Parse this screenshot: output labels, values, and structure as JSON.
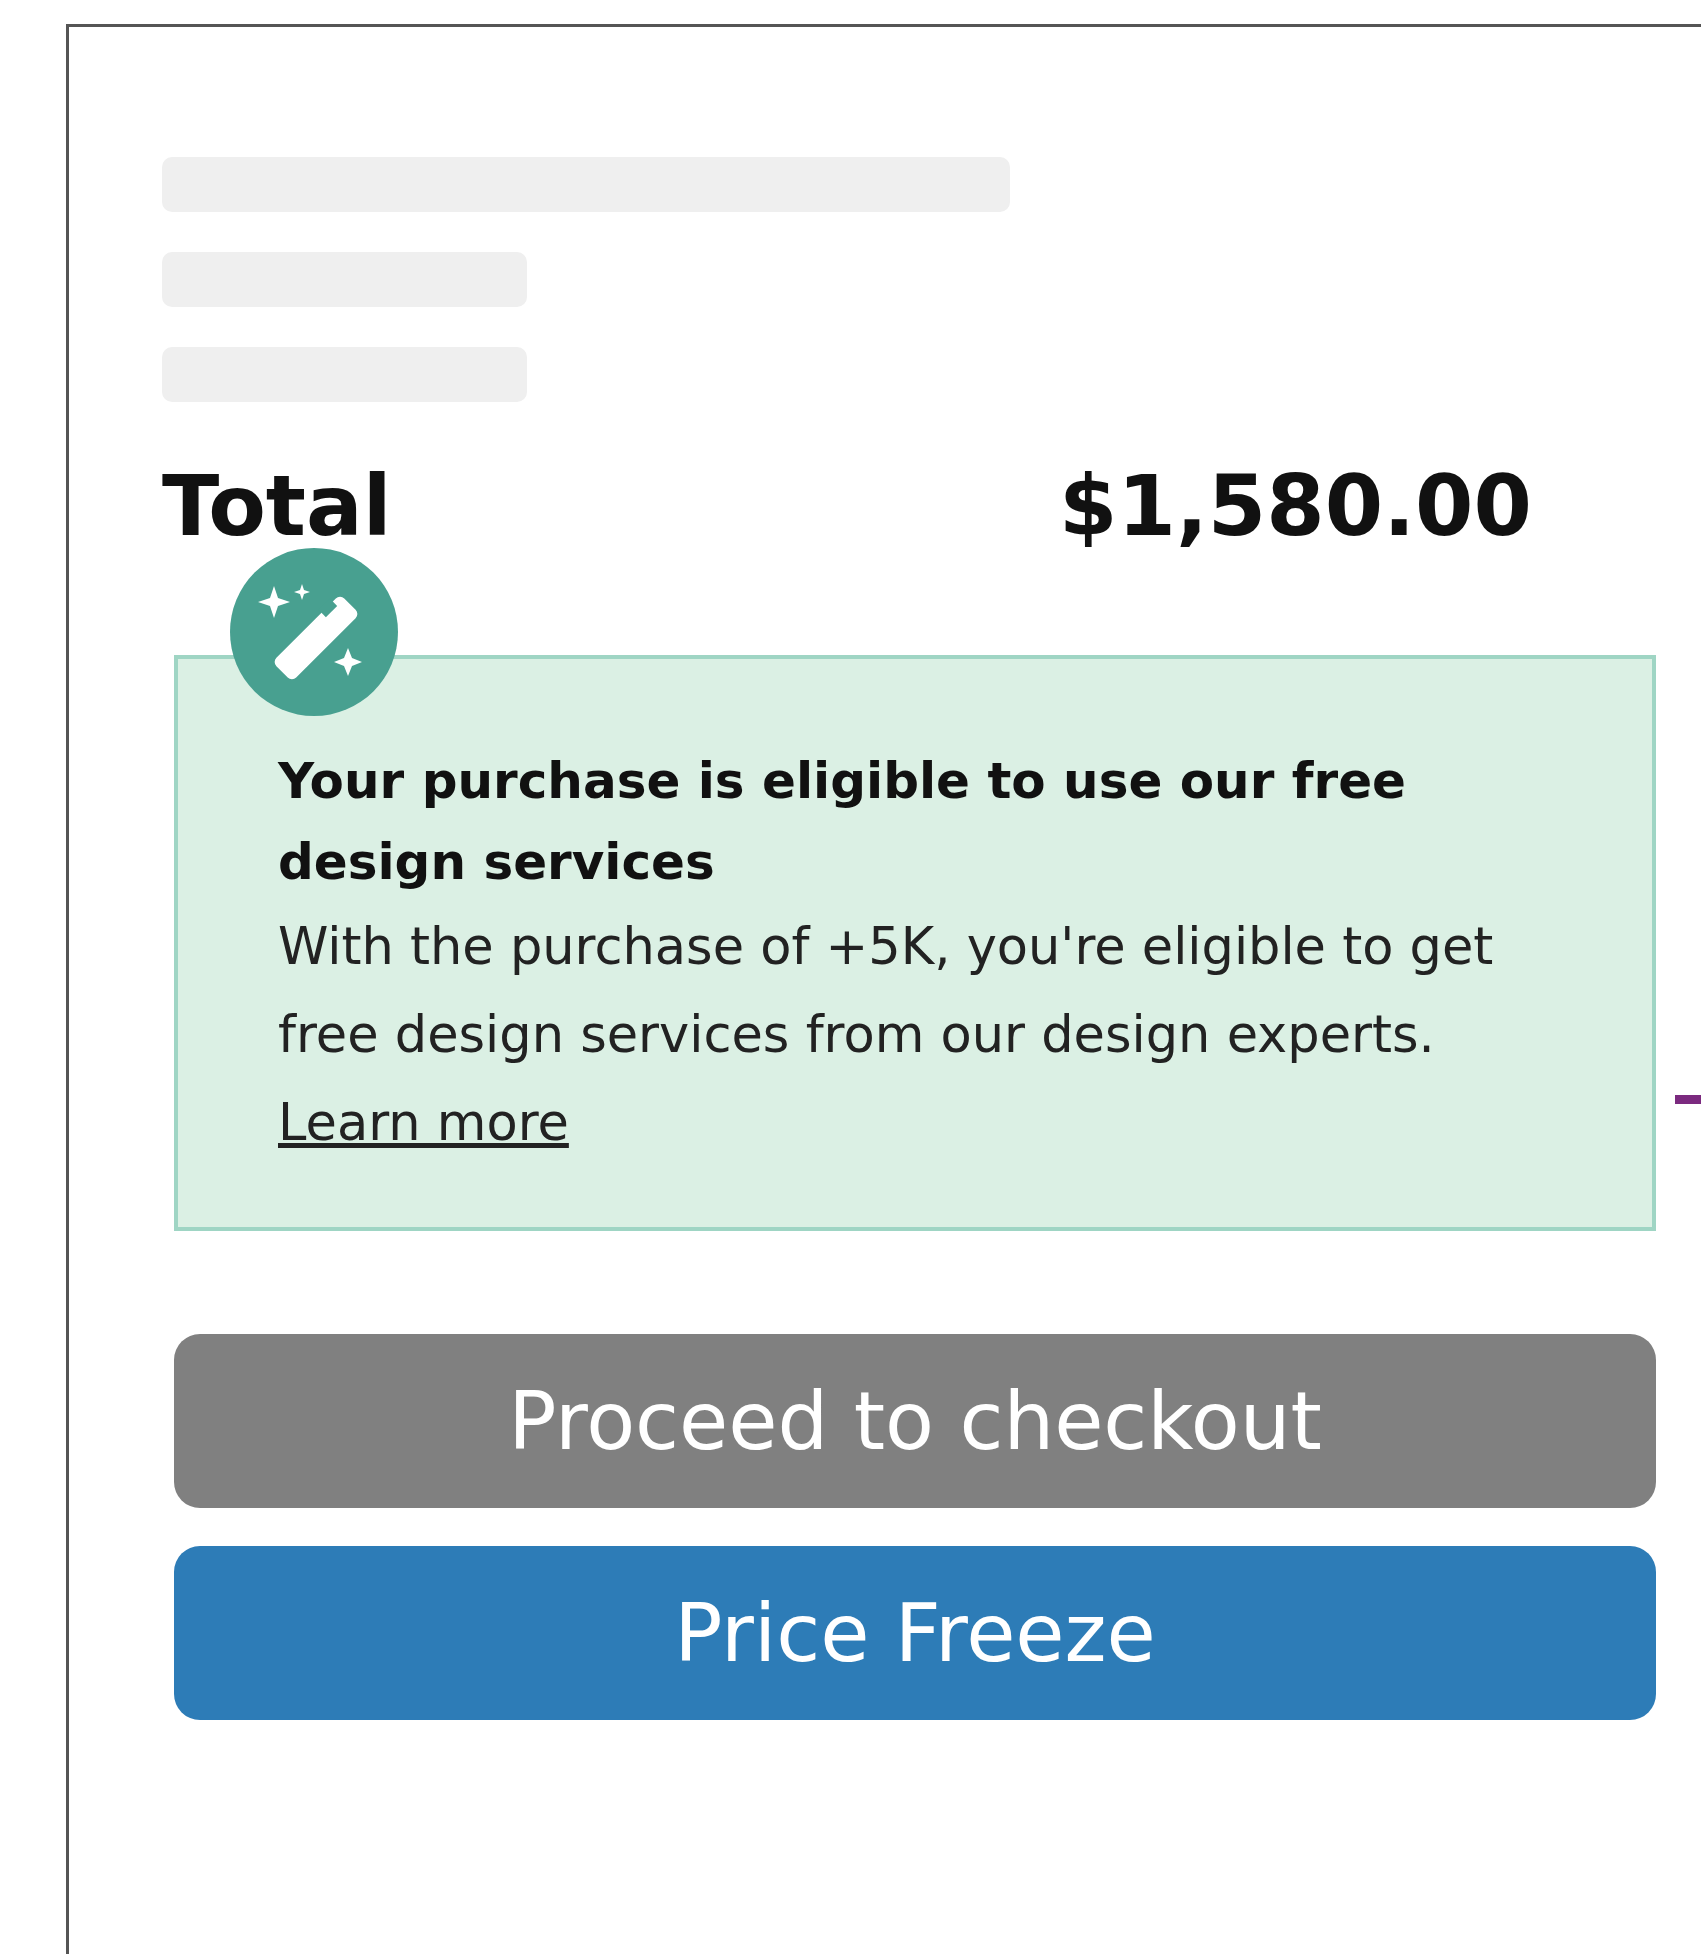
{
  "loading_rows": [
    {
      "kind": "long"
    },
    {
      "kind": "short"
    },
    {
      "kind": "short"
    }
  ],
  "total": {
    "label": "Total",
    "amount": "$1,580.00"
  },
  "notice": {
    "title": "Your purchase is eligible to use our free design services",
    "body": "With the purchase of +5K, you're eligible to get free design services from our design experts.",
    "link": "Learn more"
  },
  "buttons": [
    {
      "label": "Proceed to checkout",
      "kind": "secondary",
      "disabled": true
    },
    {
      "label": "Price Freeze",
      "kind": "primary",
      "disabled": false
    }
  ]
}
